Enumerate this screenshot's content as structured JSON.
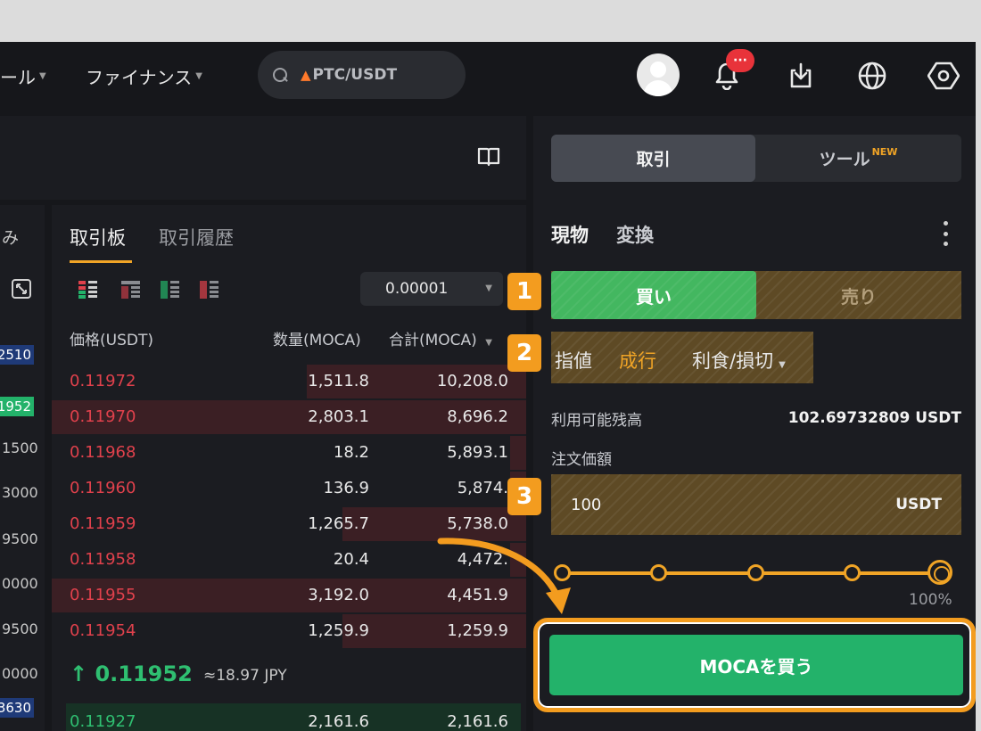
{
  "nav": {
    "tools_label": "ール",
    "finance_label": "ファイナンス",
    "search_placeholder": "PTC/USDT",
    "notif_badge": "···"
  },
  "left_strip": {
    "header": "み",
    "badges": [
      "2510",
      "1952"
    ],
    "values": [
      "1500",
      "3000",
      "9500",
      "0000",
      "9500",
      "0000"
    ],
    "bottom_badge": "3630"
  },
  "orderbook": {
    "tabs": [
      "取引板",
      "取引履歴"
    ],
    "precision": "0.00001",
    "headers": {
      "price": "価格(USDT)",
      "qty": "数量(MOCA)",
      "total": "合計(MOCA)"
    },
    "asks": [
      {
        "price": "0.11972",
        "qty": "1,511.8",
        "total": "10,208.0",
        "depth": 0.68
      },
      {
        "price": "0.11970",
        "qty": "2,803.1",
        "total": "8,696.2",
        "depth": 1.0
      },
      {
        "price": "0.11968",
        "qty": "18.2",
        "total": "5,893.1",
        "depth": 0.05
      },
      {
        "price": "0.11960",
        "qty": "136.9",
        "total": "5,874.",
        "depth": 0.05
      },
      {
        "price": "0.11959",
        "qty": "1,265.7",
        "total": "5,738.0",
        "depth": 0.57
      },
      {
        "price": "0.11958",
        "qty": "20.4",
        "total": "4,472.",
        "depth": 0.05
      },
      {
        "price": "0.11955",
        "qty": "3,192.0",
        "total": "4,451.9",
        "depth": 1.0
      },
      {
        "price": "0.11954",
        "qty": "1,259.9",
        "total": "1,259.9",
        "depth": 0.57
      }
    ],
    "last_price": "↑ 0.11952",
    "last_price_jpy": "≈18.97 JPY",
    "bid": {
      "price": "0.11927",
      "qty": "2,161.6",
      "total": "2,161.6"
    }
  },
  "trade": {
    "mode_tabs": {
      "active": "取引",
      "tools": "ツール",
      "new_badge": "NEW"
    },
    "sub_tabs": [
      "現物",
      "変換"
    ],
    "buy_label": "買い",
    "sell_label": "売り",
    "order_types": [
      "指値",
      "成行",
      "利食/損切"
    ],
    "available_label": "利用可能残高",
    "available_value": "102.69732809 USDT",
    "order_amount_label": "注文価額",
    "amount_value": "100",
    "amount_unit": "USDT",
    "slider_min": "0",
    "slider_max": "100%",
    "slider_value": 1.0,
    "submit_label": "MOCAを買う"
  },
  "steps": [
    "1",
    "2",
    "3"
  ],
  "colors": {
    "accent": "#f39c1f",
    "buy": "#23b26a",
    "ask": "#e0414c",
    "background": "#16171b"
  }
}
